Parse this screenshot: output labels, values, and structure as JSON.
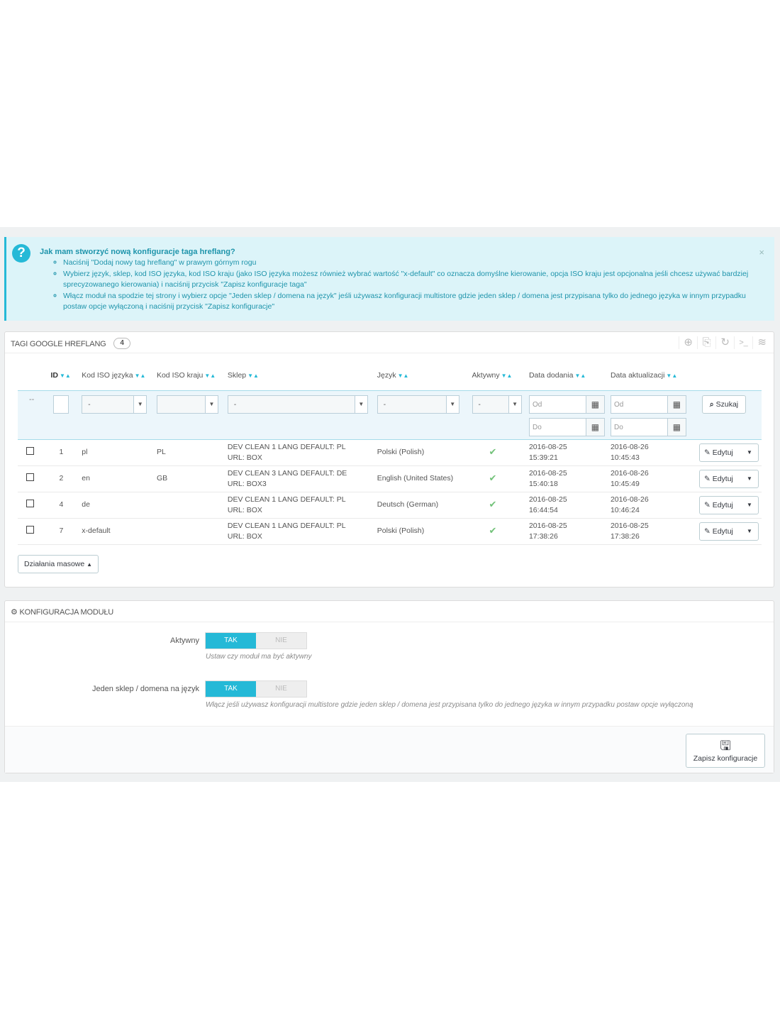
{
  "alert": {
    "title": "Jak mam stworzyć nową konfiguracje taga hreflang?",
    "close": "×",
    "items": [
      "Naciśnij \"Dodaj nowy tag hreflang\" w prawym górnym rogu",
      "Wybierz język, sklep, kod ISO języka, kod ISO kraju (jako ISO języka możesz również wybrać wartość \"x-default\" co oznacza domyślne kierowanie, opcja ISO kraju jest opcjonalna jeśli chcesz używać bardziej sprecyzowanego kierowania) i naciśnij przycisk \"Zapisz konfiguracje taga\"",
      "Włącz moduł na spodzie tej strony i wybierz opcje \"Jeden sklep / domena na język\" jeśli używasz konfiguracji multistore gdzie jeden sklep / domena jest przypisana tylko do jednego języka w innym przypadku postaw opcje wyłączoną i naciśnij przycisk \"Zapisz konfiguracje\""
    ]
  },
  "list_panel": {
    "title": "TAGI GOOGLE HREFLANG",
    "count": "4",
    "columns": {
      "id": "ID",
      "lang_iso": "Kod ISO języka",
      "country_iso": "Kod ISO kraju",
      "shop": "Sklep",
      "language": "Język",
      "active": "Aktywny",
      "date_add": "Data dodania",
      "date_upd": "Data aktualizacji"
    },
    "filters": {
      "dash": "--",
      "select_value": "-",
      "from": "Od",
      "to": "Do",
      "search": "Szukaj"
    },
    "rows": [
      {
        "id": "1",
        "lang_iso": "pl",
        "country_iso": "PL",
        "shop": "DEV CLEAN 1 LANG DEFAULT: PL URL: BOX",
        "language": "Polski (Polish)",
        "date_add": "2016-08-25 15:39:21",
        "date_upd": "2016-08-26 10:45:43"
      },
      {
        "id": "2",
        "lang_iso": "en",
        "country_iso": "GB",
        "shop": "DEV CLEAN 3 LANG DEFAULT: DE URL: BOX3",
        "language": "English (United States)",
        "date_add": "2016-08-25 15:40:18",
        "date_upd": "2016-08-26 10:45:49"
      },
      {
        "id": "4",
        "lang_iso": "de",
        "country_iso": "",
        "shop": "DEV CLEAN 1 LANG DEFAULT: PL URL: BOX",
        "language": "Deutsch (German)",
        "date_add": "2016-08-25 16:44:54",
        "date_upd": "2016-08-26 10:46:24"
      },
      {
        "id": "7",
        "lang_iso": "x-default",
        "country_iso": "",
        "shop": "DEV CLEAN 1 LANG DEFAULT: PL URL: BOX",
        "language": "Polski (Polish)",
        "date_add": "2016-08-25 17:38:26",
        "date_upd": "2016-08-25 17:38:26"
      }
    ],
    "edit_label": "Edytuj",
    "bulk_label": "Działania masowe"
  },
  "config_panel": {
    "title": "KONFIGURACJA MODUŁU",
    "active_label": "Aktywny",
    "active_help": "Ustaw czy moduł ma być aktywny",
    "multistore_label": "Jeden sklep / domena na język",
    "multistore_help": "Włącz jeśli używasz konfiguracji multistore gdzie jeden sklep / domena jest przypisana tylko do jednego języka w innym przypadku postaw opcje wyłączoną",
    "yes": "TAK",
    "no": "NIE",
    "save": "Zapisz konfiguracje"
  }
}
